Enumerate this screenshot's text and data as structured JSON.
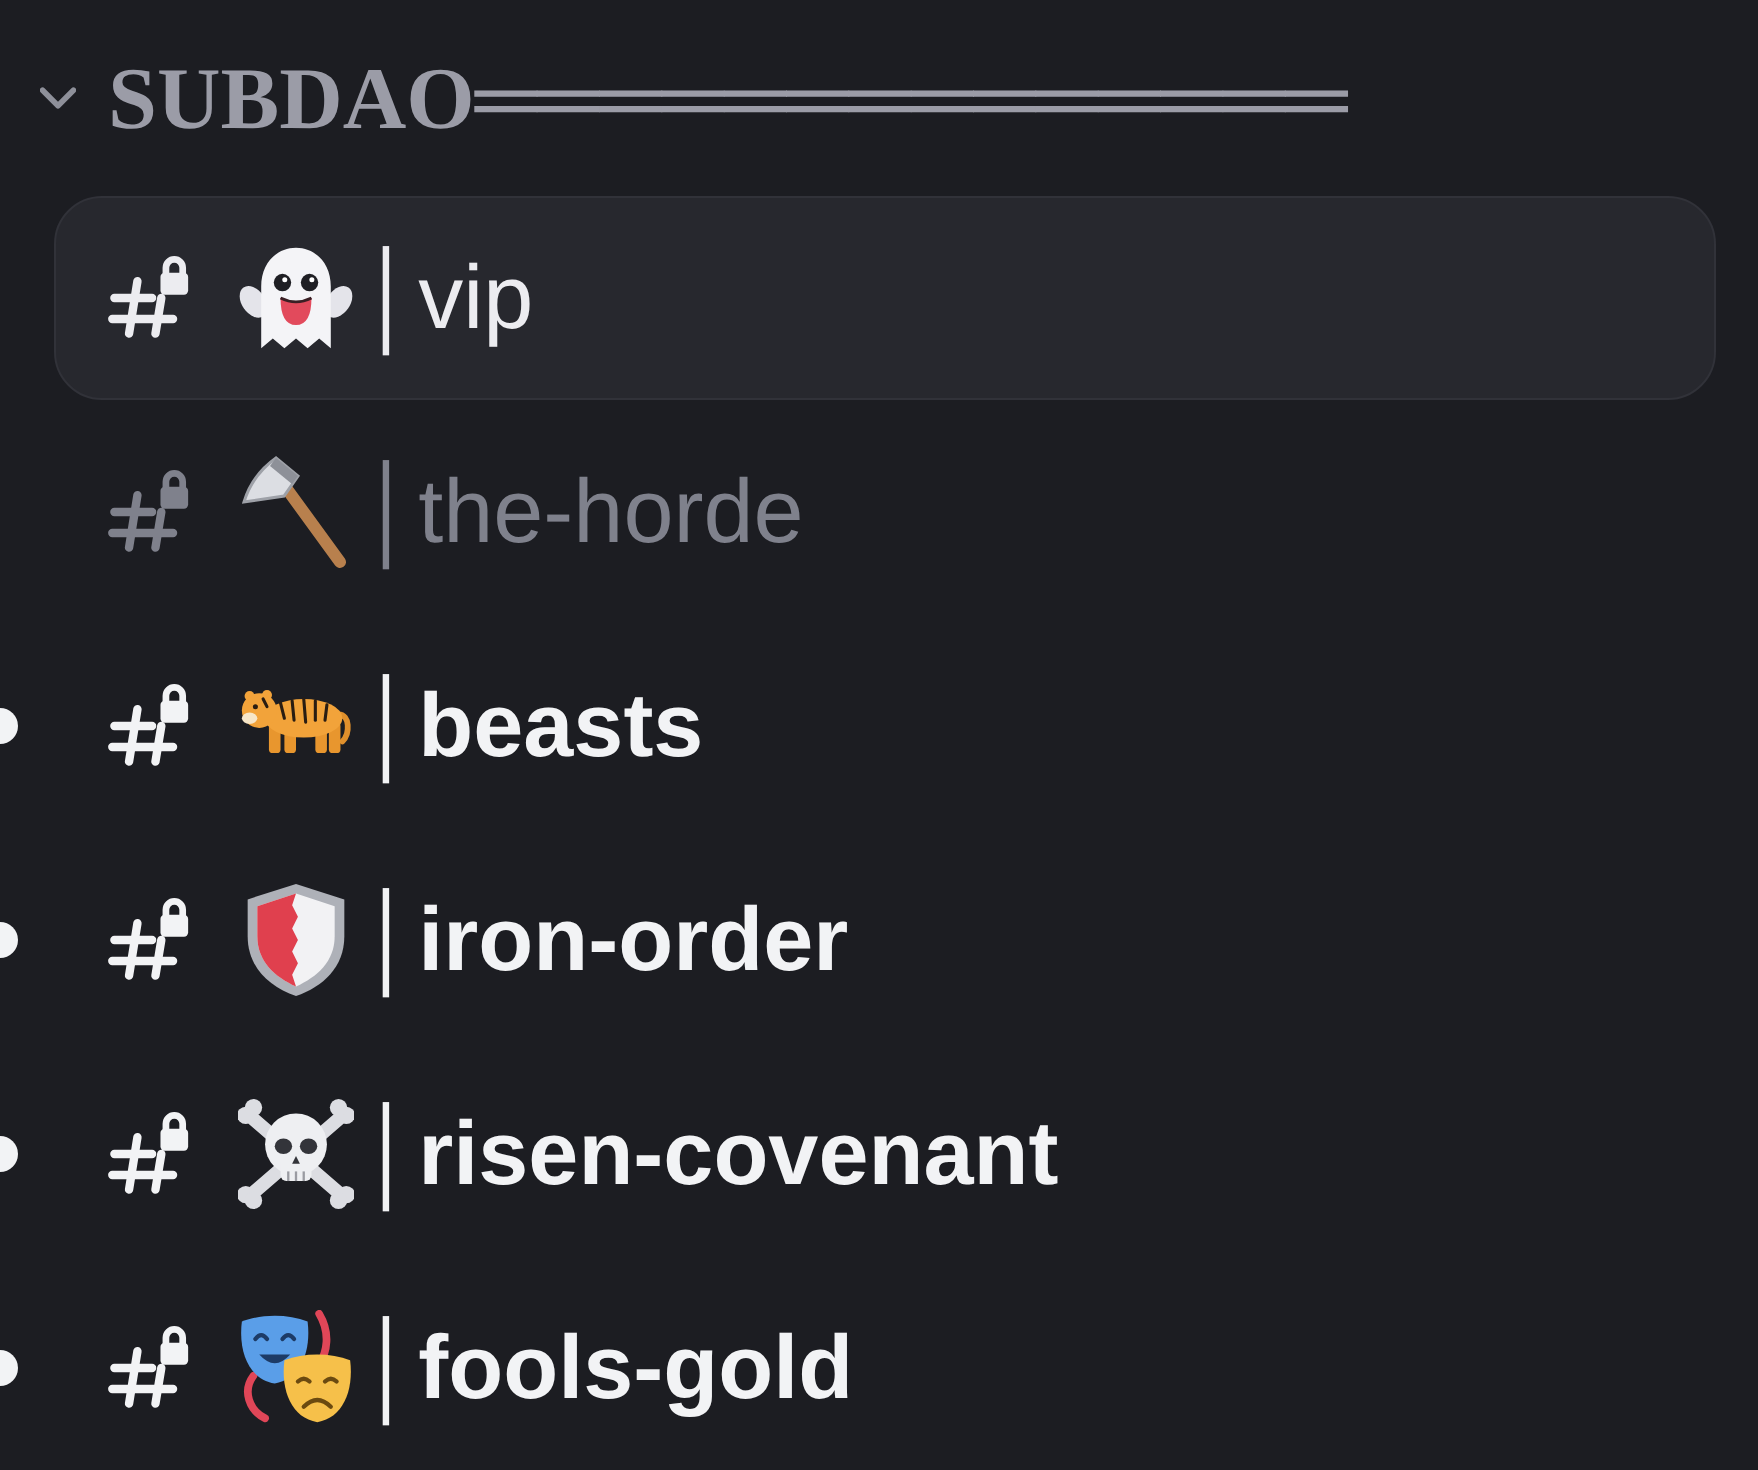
{
  "category": {
    "name": "SUBDAO══════════════",
    "expanded": true
  },
  "channels": [
    {
      "name": "│vip",
      "selected": true,
      "unread": false
    },
    {
      "name": "│the-horde",
      "selected": false,
      "unread": false
    },
    {
      "name": "│beasts",
      "selected": false,
      "unread": true
    },
    {
      "name": "│iron-order",
      "selected": false,
      "unread": true
    },
    {
      "name": "│risen-covenant",
      "selected": false,
      "unread": true
    },
    {
      "name": "│fools-gold",
      "selected": false,
      "unread": true
    }
  ]
}
